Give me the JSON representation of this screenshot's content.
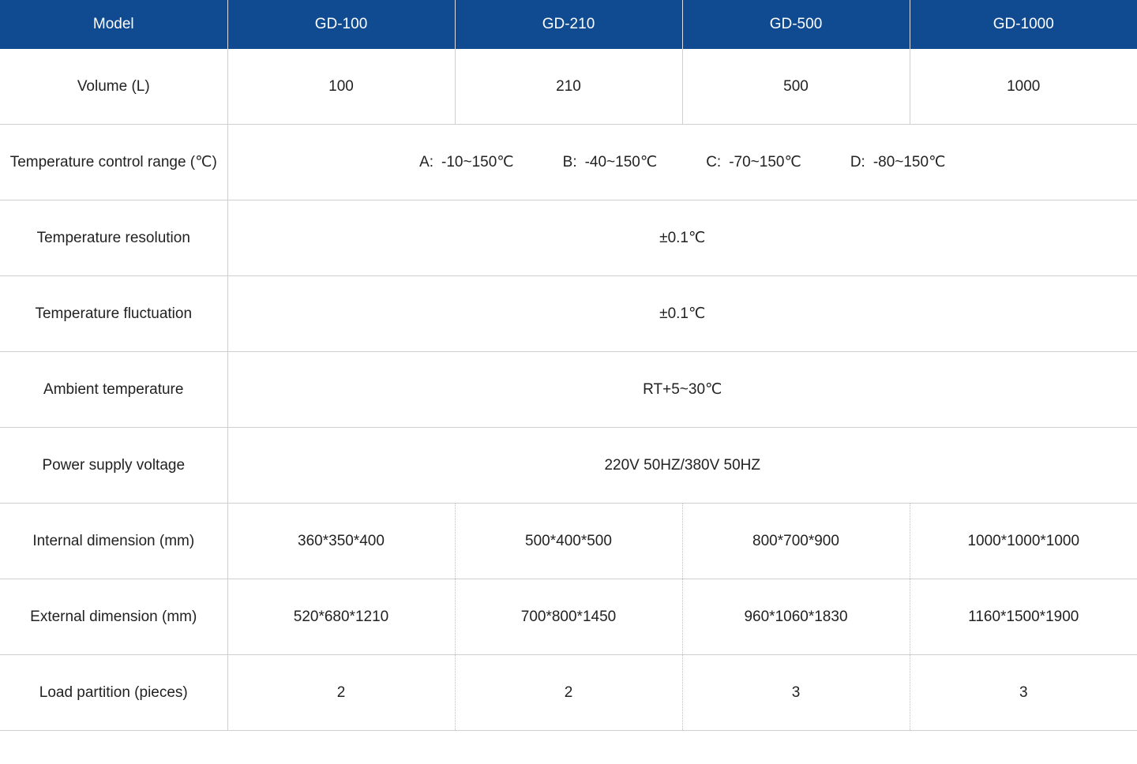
{
  "header": [
    "Model",
    "GD-100",
    "GD-210",
    "GD-500",
    "GD-1000"
  ],
  "volume": {
    "label": "Volume (L)",
    "values": [
      "100",
      "210",
      "500",
      "1000"
    ]
  },
  "temp_range": {
    "label": "Temperature control range (℃)",
    "options": [
      {
        "key": "A:",
        "value": "-10~150℃"
      },
      {
        "key": "B:",
        "value": "-40~150℃"
      },
      {
        "key": "C:",
        "value": "-70~150℃"
      },
      {
        "key": "D:",
        "value": "-80~150℃"
      }
    ]
  },
  "temp_resolution": {
    "label": "Temperature resolution",
    "value": "±0.1℃"
  },
  "temp_fluctuation": {
    "label": "Temperature fluctuation",
    "value": "±0.1℃"
  },
  "ambient_temp": {
    "label": "Ambient temperature",
    "value": "RT+5~30℃"
  },
  "power_supply": {
    "label": "Power supply voltage",
    "value": "220V 50HZ/380V 50HZ"
  },
  "internal_dim": {
    "label": "Internal dimension (mm)",
    "values": [
      "360*350*400",
      "500*400*500",
      "800*700*900",
      "1000*1000*1000"
    ]
  },
  "external_dim": {
    "label": "External dimension (mm)",
    "values": [
      "520*680*1210",
      "700*800*1450",
      "960*1060*1830",
      "1160*1500*1900"
    ]
  },
  "load_partition": {
    "label": "Load partition (pieces)",
    "values": [
      "2",
      "2",
      "3",
      "3"
    ]
  },
  "colors": {
    "header_bg": "#104b91",
    "header_text": "#ffffff",
    "grid": "#cfcfcf"
  }
}
